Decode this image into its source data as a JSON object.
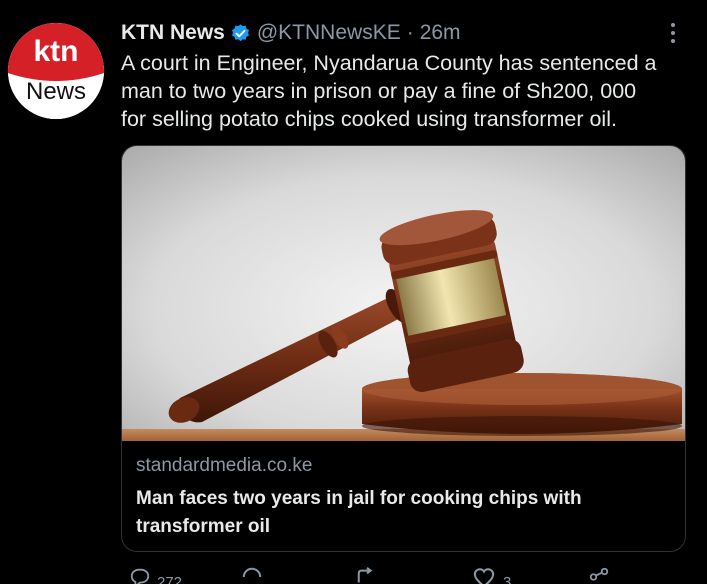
{
  "tweet": {
    "author_name": "KTN News",
    "handle": "@KTNNewsKE",
    "separator": "·",
    "time": "26m",
    "text_lines": [
      "A court in Engineer, Nyandarua County has sentenced a",
      "man to two years in prison or pay a fine of Sh200, 000",
      "for selling potato chips cooked using transformer oil."
    ],
    "avatar_logo_text": [
      "ktn",
      "News"
    ]
  },
  "card": {
    "domain": "standardmedia.co.ke",
    "title_lines": [
      "Man faces two years in jail for cooking chips with",
      "transformer oil"
    ],
    "image_description_icon": "gavel-image"
  },
  "actions": {
    "reply_count": "272",
    "retweet_count": "",
    "like_count": "3",
    "icons": [
      "reply-icon",
      "retweet-icon",
      "like-icon",
      "share-icon"
    ]
  },
  "colors": {
    "background": "#000000",
    "text_primary": "#e7e9ea",
    "text_secondary": "#8b98a5",
    "verified_blue": "#1d9bf0",
    "ktn_red": "#d62027",
    "card_border": "#2f3336"
  }
}
